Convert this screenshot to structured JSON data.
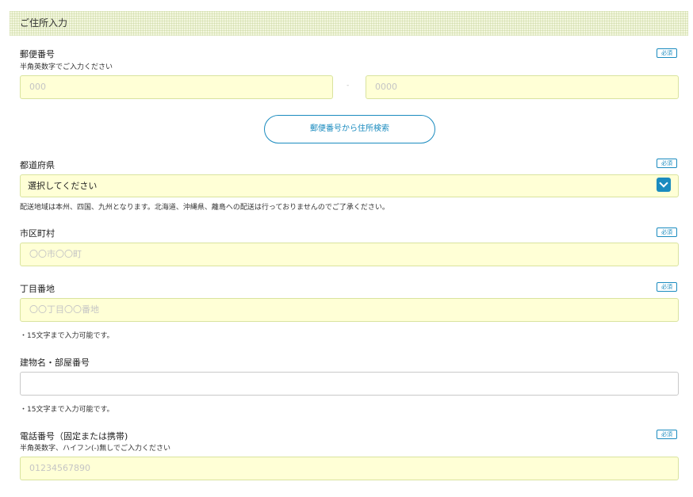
{
  "section_title": "ご住所入力",
  "required_label": "必須",
  "postal": {
    "label": "郵便番号",
    "hint": "半角英数字でご入力ください",
    "first_placeholder": "000",
    "separator": "-",
    "second_placeholder": "0000",
    "search_button": "郵便番号から住所検索"
  },
  "prefecture": {
    "label": "都道府県",
    "selected": "選択してください",
    "note": "配送地域は本州、四国、九州となります。北海道、沖縄県、離島への配送は行っておりませんのでご了承ください。"
  },
  "city": {
    "label": "市区町村",
    "placeholder": "〇〇市〇〇町"
  },
  "block": {
    "label": "丁目番地",
    "placeholder": "〇〇丁目〇〇番地",
    "note": "・15文字まで入力可能です。"
  },
  "building": {
    "label": "建物名・部屋番号",
    "placeholder": "",
    "note": "・15文字まで入力可能です。"
  },
  "phone": {
    "label": "電話番号（固定または携帯)",
    "hint": "半角英数字、ハイフン(-)無しでご入力ください",
    "placeholder": "01234567890"
  },
  "colors": {
    "accent": "#1a8bbf",
    "field_bg": "#ffffd6",
    "header_bg": "#f3f7df"
  },
  "icons": {
    "select_toggle": "chevron-down-icon"
  }
}
